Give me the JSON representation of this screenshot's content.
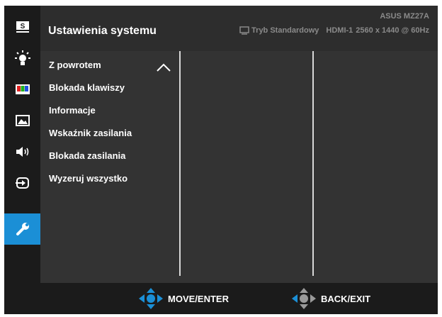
{
  "header": {
    "model": "ASUS MZ27A",
    "title": "Ustawienia systemu",
    "mode": "Tryb Standardowy",
    "input": "HDMI-1",
    "resolution": "2560 x 1440 @ 60Hz"
  },
  "sidebar": {
    "items": [
      {
        "icon": "splendid-s-icon"
      },
      {
        "icon": "blue-light-filter-icon"
      },
      {
        "icon": "color-bars-icon"
      },
      {
        "icon": "image-icon"
      },
      {
        "icon": "speaker-icon"
      },
      {
        "icon": "input-select-icon"
      },
      {
        "icon": "wrench-icon",
        "active": true
      }
    ],
    "active_color": "#1b8fd6"
  },
  "menu": {
    "items": [
      "Z powrotem",
      "Blokada klawiszy",
      "Informacje",
      "Wskaźnik zasilania",
      "Blokada zasilania",
      "Wyzeruj wszystko"
    ]
  },
  "footer": {
    "move_label": "MOVE/ENTER",
    "back_label": "BACK/EXIT"
  }
}
